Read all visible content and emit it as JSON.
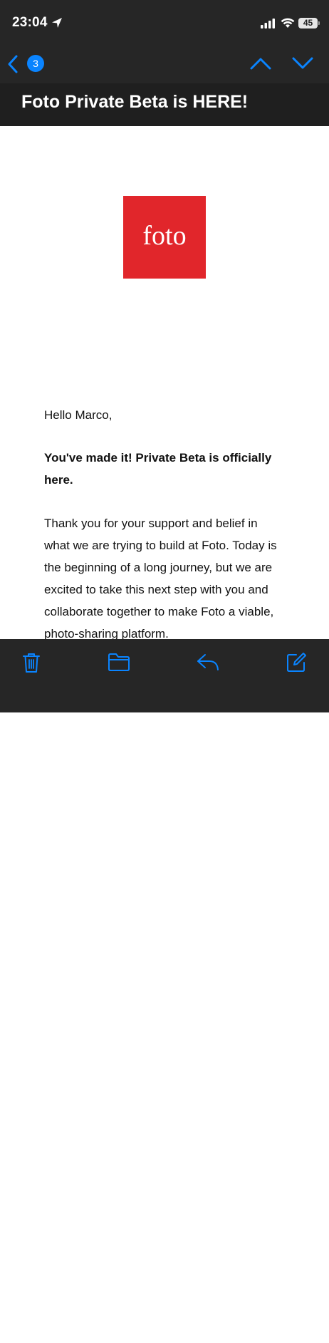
{
  "status_bar": {
    "time": "23:04",
    "battery": "45"
  },
  "nav": {
    "unread_count": "3"
  },
  "email": {
    "subject": "Foto Private Beta is HERE!",
    "logo_text": "foto",
    "greeting": "Hello Marco,",
    "headline": "You've made it! Private Beta is officially here.",
    "paragraph": "Thank you for your support and belief in what we are trying to build at Foto. Today is the beginning of a long journey, but we are excited to take this next step with you and collaborate together to make Foto a viable, photo-sharing platform."
  },
  "toolbar": {
    "icons": [
      "trash-icon",
      "folder-icon",
      "reply-icon",
      "compose-icon"
    ]
  },
  "colors": {
    "accent": "#0a84ff",
    "chrome_dark": "#262626",
    "subject_bar": "#1f1f1f",
    "logo_red": "#e1262b"
  }
}
